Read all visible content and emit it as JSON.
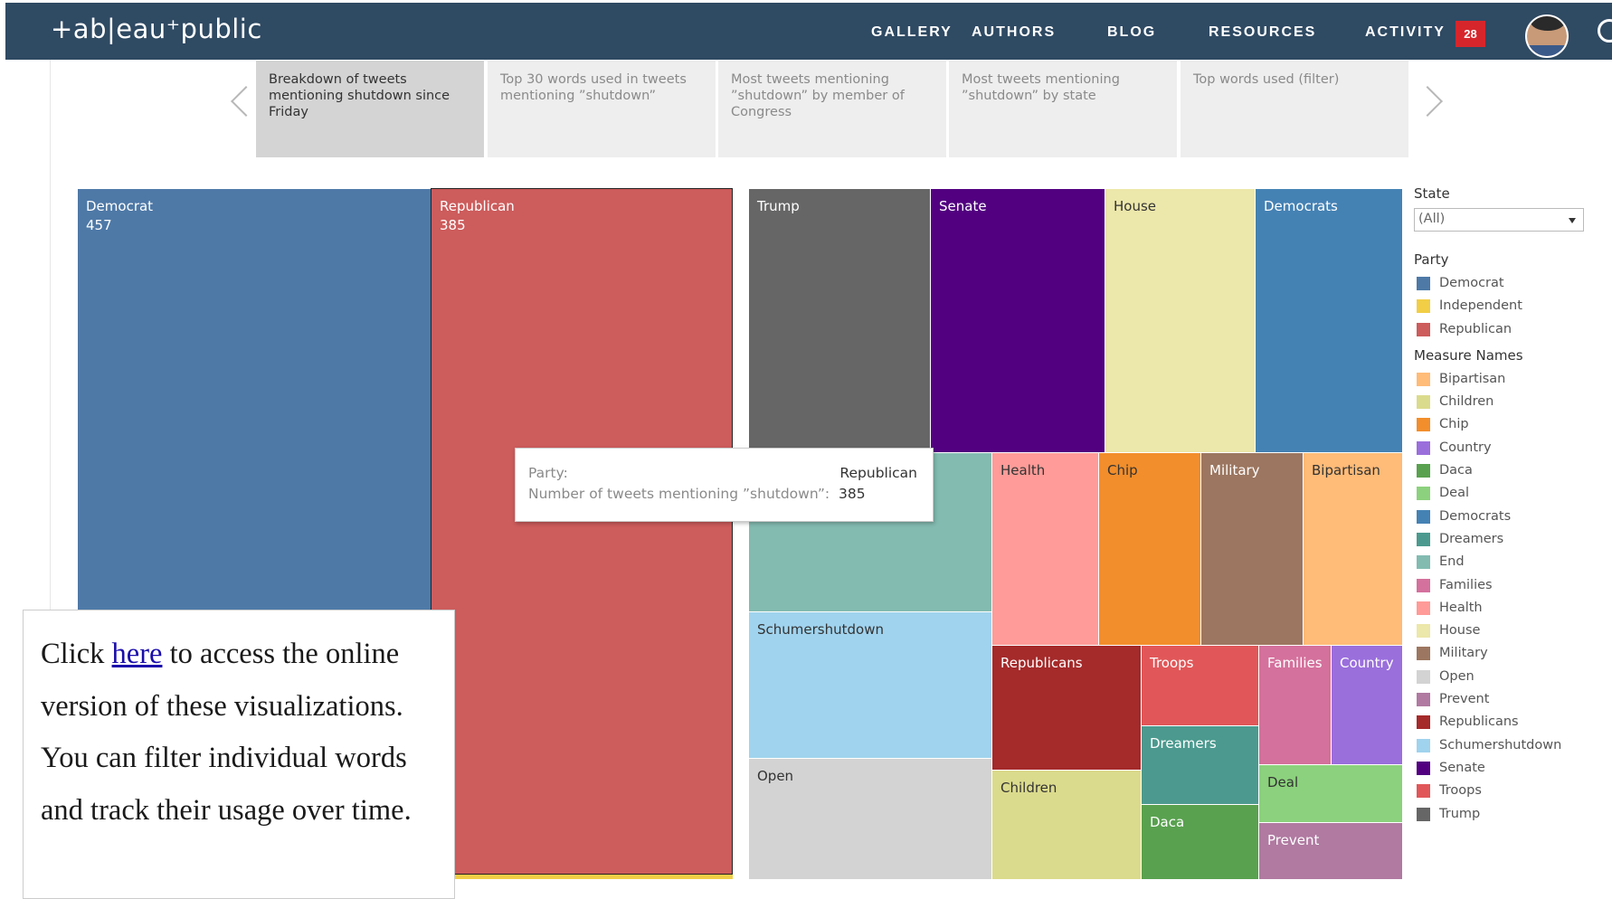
{
  "header": {
    "logo": "+ab|eau⁺public",
    "nav": [
      "GALLERY",
      "AUTHORS",
      "BLOG",
      "RESOURCES",
      "ACTIVITY"
    ],
    "activity_count": "28"
  },
  "story_points": [
    "Breakdown of tweets mentioning shutdown since Friday",
    "Top 30 words used in tweets mentioning ”shutdown”",
    "Most tweets mentioning ”shutdown” by member of Congress",
    "Most tweets mentioning ”shutdown” by state",
    "Top words used (filter)"
  ],
  "party_treemap": [
    {
      "label": "Democrat",
      "value": "457",
      "color": "#4e79a7"
    },
    {
      "label": "Republican",
      "value": "385",
      "color": "#cd5c5c"
    }
  ],
  "word_treemap": [
    {
      "label": "Trump",
      "color": "#666666"
    },
    {
      "label": "Senate",
      "color": "#520080"
    },
    {
      "label": "House",
      "color": "#ece7aa"
    },
    {
      "label": "Democrats",
      "color": "#4582b4"
    },
    {
      "label": "End",
      "color": "#83bbb1"
    },
    {
      "label": "Health",
      "color": "#ff9b98"
    },
    {
      "label": "Chip",
      "color": "#f28e2b"
    },
    {
      "label": "Military",
      "color": "#9c7660"
    },
    {
      "label": "Bipartisan",
      "color": "#ffbb78"
    },
    {
      "label": "Schumershutdown",
      "color": "#a0d3ee"
    },
    {
      "label": "Republicans",
      "color": "#a52a2a"
    },
    {
      "label": "Troops",
      "color": "#e15759"
    },
    {
      "label": "Families",
      "color": "#d4719c"
    },
    {
      "label": "Country",
      "color": "#9a6fdc"
    },
    {
      "label": "Dreamers",
      "color": "#4c9a8f"
    },
    {
      "label": "Open",
      "color": "#d3d3d3"
    },
    {
      "label": "Children",
      "color": "#dbdb8d"
    },
    {
      "label": "Deal",
      "color": "#8cd17d"
    },
    {
      "label": "Daca",
      "color": "#59a14f"
    },
    {
      "label": "Prevent",
      "color": "#b07aa1"
    }
  ],
  "tooltip": {
    "party_label": "Party:",
    "party_value": "Republican",
    "measure_label": "Number of tweets mentioning ”shutdown”:",
    "measure_value": "385"
  },
  "filters": {
    "state_title": "State",
    "state_value": "(All)"
  },
  "legend_party": {
    "title": "Party",
    "items": [
      {
        "label": "Democrat",
        "color": "#4e79a7"
      },
      {
        "label": "Independent",
        "color": "#f1ce46"
      },
      {
        "label": "Republican",
        "color": "#cd5c5c"
      }
    ]
  },
  "legend_measures": {
    "title": "Measure Names",
    "items": [
      {
        "label": "Bipartisan",
        "color": "#ffbb78"
      },
      {
        "label": "Children",
        "color": "#dbdb8d"
      },
      {
        "label": "Chip",
        "color": "#f28e2b"
      },
      {
        "label": "Country",
        "color": "#9a6fdc"
      },
      {
        "label": "Daca",
        "color": "#59a14f"
      },
      {
        "label": "Deal",
        "color": "#8cd17d"
      },
      {
        "label": "Democrats",
        "color": "#4582b4"
      },
      {
        "label": "Dreamers",
        "color": "#4c9a8f"
      },
      {
        "label": "End",
        "color": "#83bbb1"
      },
      {
        "label": "Families",
        "color": "#d4719c"
      },
      {
        "label": "Health",
        "color": "#ff9b98"
      },
      {
        "label": "House",
        "color": "#ece7aa"
      },
      {
        "label": "Military",
        "color": "#9c7660"
      },
      {
        "label": "Open",
        "color": "#d3d3d3"
      },
      {
        "label": "Prevent",
        "color": "#b07aa1"
      },
      {
        "label": "Republicans",
        "color": "#a52a2a"
      },
      {
        "label": "Schumershutdown",
        "color": "#a0d3ee"
      },
      {
        "label": "Senate",
        "color": "#520080"
      },
      {
        "label": "Troops",
        "color": "#e15759"
      },
      {
        "label": "Trump",
        "color": "#666666"
      }
    ]
  },
  "overlay": {
    "text_before": "Click ",
    "link": "here",
    "text_after": " to access the online version of these visualizations. You can filter individual words and track their usage over time."
  }
}
